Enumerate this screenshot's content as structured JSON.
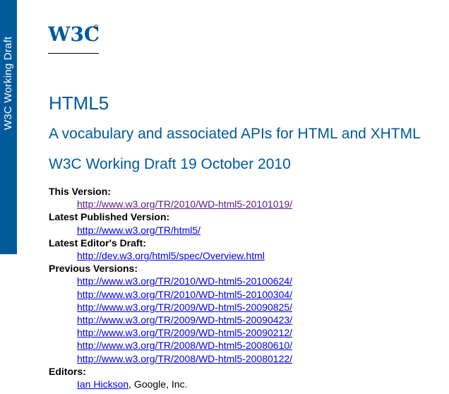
{
  "status_bar": {
    "label": "W3C Working Draft",
    "color": "#005a9c"
  },
  "logo": {
    "text": "W3C"
  },
  "title": "HTML5",
  "subtitle": "A vocabulary and associated APIs for HTML and XHTML",
  "date_line": "W3C Working Draft 19 October 2010",
  "metadata": {
    "this_version_label": "This Version:",
    "this_version_url": "http://www.w3.org/TR/2010/WD-html5-20101019/",
    "latest_published_label": "Latest Published Version:",
    "latest_published_url": "http://www.w3.org/TR/html5/",
    "latest_editors_draft_label": "Latest Editor's Draft:",
    "latest_editors_draft_url": "http://dev.w3.org/html5/spec/Overview.html",
    "previous_versions_label": "Previous Versions:",
    "previous_versions": [
      "http://www.w3.org/TR/2010/WD-html5-20100624/",
      "http://www.w3.org/TR/2010/WD-html5-20100304/",
      "http://www.w3.org/TR/2009/WD-html5-20090825/",
      "http://www.w3.org/TR/2009/WD-html5-20090423/",
      "http://www.w3.org/TR/2009/WD-html5-20090212/",
      "http://www.w3.org/TR/2008/WD-html5-20080610/",
      "http://www.w3.org/TR/2008/WD-html5-20080122/"
    ],
    "editors_label": "Editors:",
    "editor_name": "Ian Hickson",
    "editor_affiliation": ", Google, Inc."
  },
  "colors": {
    "heading": "#005a9c",
    "link": "#0000ee",
    "visited_link": "#551a8b"
  }
}
